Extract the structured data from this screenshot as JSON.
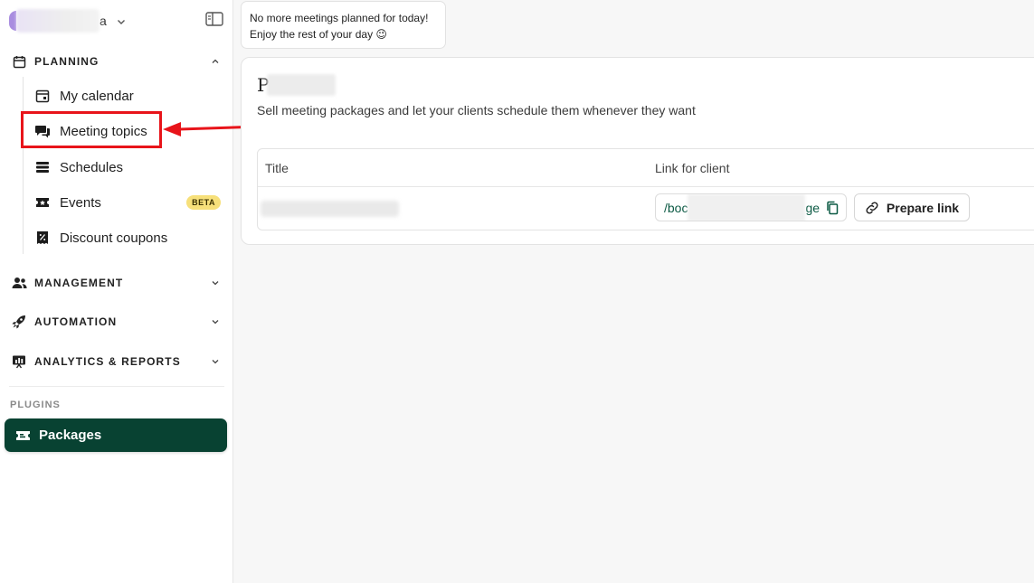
{
  "account": {
    "name_suffix": "a"
  },
  "sidebar": {
    "sections": {
      "planning": {
        "label": "PLANNING"
      },
      "management": {
        "label": "MANAGEMENT"
      },
      "automation": {
        "label": "AUTOMATION"
      },
      "analytics": {
        "label": "ANALYTICS & REPORTS"
      }
    },
    "planning_items": [
      {
        "label": "My calendar",
        "icon": "calendar-icon"
      },
      {
        "label": "Meeting topics",
        "icon": "chat-bubbles-icon"
      },
      {
        "label": "Schedules",
        "icon": "stack-icon"
      },
      {
        "label": "Events",
        "icon": "ticket-icon",
        "badge": "BETA"
      },
      {
        "label": "Discount coupons",
        "icon": "coupon-icon"
      }
    ],
    "plugins_label": "PLUGINS",
    "packages_label": "Packages"
  },
  "toast": {
    "line1": "No more meetings planned for today!",
    "line2": "Enjoy the rest of your day 😉"
  },
  "card": {
    "title_visible": "P",
    "subtitle": "Sell meeting packages and let your clients schedule them whenever they want",
    "table": {
      "headers": [
        "Title",
        "Link for client"
      ],
      "row": {
        "link_prefix": "/boc",
        "link_suffix": "ge",
        "prepare_label": "Prepare link"
      }
    }
  },
  "colors": {
    "accent_dark_green": "#084232",
    "highlight_red": "#e8141a",
    "beta_yellow": "#f7e07a"
  }
}
